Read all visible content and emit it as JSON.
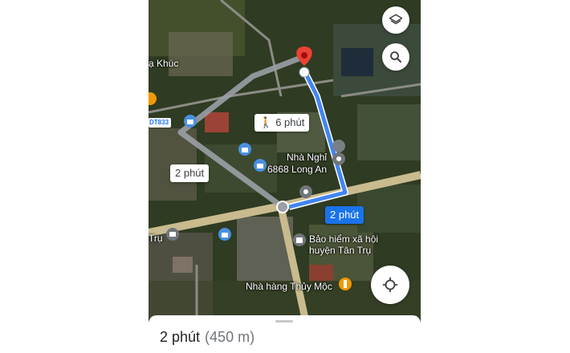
{
  "map": {
    "route_duration_label": "2 phút",
    "walk_label": "6 phút",
    "alt_route_label": "2 phút",
    "places": {
      "area_top_left": "ạ Khúc",
      "area_left": "Trụ",
      "road_badge": "DT833",
      "hotel_line1": "Nhà Nghỉ",
      "hotel_line2": "6868 Long An",
      "insurance_line1": "Bảo hiểm xã hội",
      "insurance_line2": "huyện Tân Trụ",
      "restaurant": "Nhà hàng Thủy Mộc"
    },
    "colors": {
      "route": "#4285f4",
      "alt_route": "#9aa0a6",
      "destination_pin": "#ea4335",
      "active_callout": "#1a73e8"
    }
  },
  "controls": {
    "layers_icon": "layers-icon",
    "search_icon": "search-icon",
    "locate_icon": "my-location-icon"
  },
  "bottom_sheet": {
    "duration": "2 phút",
    "distance": "(450 m)"
  }
}
